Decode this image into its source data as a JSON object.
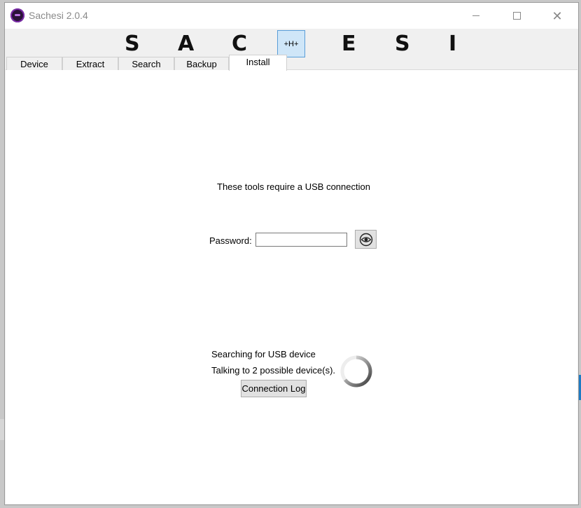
{
  "window": {
    "title": "Sachesi 2.0.4"
  },
  "header": {
    "letters": [
      "S",
      "A",
      "C",
      "E",
      "S",
      "I"
    ],
    "logo_text": "+H+"
  },
  "tabs": [
    {
      "label": "Device"
    },
    {
      "label": "Extract"
    },
    {
      "label": "Search"
    },
    {
      "label": "Backup"
    },
    {
      "label": "Install",
      "active": true
    }
  ],
  "install": {
    "usb_notice": "These tools require a USB connection",
    "password_label": "Password:",
    "password_value": "",
    "status_searching": "Searching for USB device",
    "status_talking": "Talking to 2 possible device(s).",
    "connection_log_label": "Connection Log"
  },
  "icons": {
    "app": "sachesi-app-icon",
    "reveal_password": "eye-icon",
    "busy": "spinner-icon"
  }
}
